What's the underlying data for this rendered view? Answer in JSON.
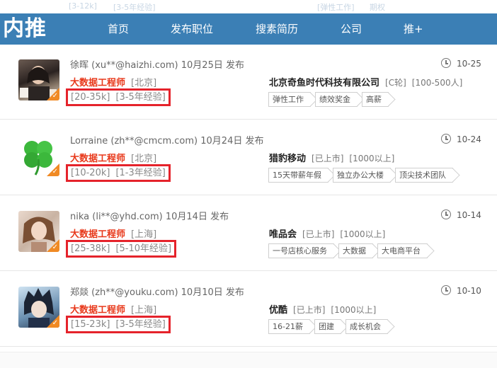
{
  "header": {
    "logo": "内推",
    "nav": [
      "首页",
      "发布职位",
      "搜素简历",
      "公司",
      "推+"
    ],
    "ghost_text": [
      "[3-12k]",
      "[3-5年经验]",
      "[弹性工作]",
      "期权"
    ]
  },
  "colors": {
    "nav_bg": "#3b7fb5",
    "job_title": "#e8381a",
    "highlight_box": "#e5232b",
    "badge": "#f08a24"
  },
  "posts": [
    {
      "poster_name": "徐晖",
      "poster_email": "(xu**@haizhi.com)",
      "posted": "10月25日 发布",
      "job_title": "大数据工程师",
      "city": "[北京]",
      "salary": "[20-35k]",
      "experience": "[3-5年经验]",
      "company": "北京奇鱼时代科技有限公司",
      "company_stage": "[C轮]",
      "company_size": "[100-500人]",
      "tags": [
        "弹性工作",
        "绩效奖金",
        "高薪"
      ],
      "date": "10-25",
      "avatar": "photo-woman-portrait"
    },
    {
      "poster_name": "Lorraine",
      "poster_email": "(zh**@cmcm.com)",
      "posted": "10月24日 发布",
      "job_title": "大数据工程师",
      "city": "[北京]",
      "salary": "[10-20k]",
      "experience": "[1-3年经验]",
      "company": "猎豹移动",
      "company_stage": "[已上市]",
      "company_size": "[1000以上]",
      "tags": [
        "15天带薪年假",
        "独立办公大楼",
        "顶尖技术团队"
      ],
      "date": "10-24",
      "avatar": "four-leaf-clover"
    },
    {
      "poster_name": "nika",
      "poster_email": "(li**@yhd.com)",
      "posted": "10月14日 发布",
      "job_title": "大数据工程师",
      "city": "[上海]",
      "salary": "[25-38k]",
      "experience": "[5-10年经验]",
      "company": "唯品会",
      "company_stage": "[已上市]",
      "company_size": "[1000以上]",
      "tags": [
        "一号店核心服务",
        "大数据",
        "大电商平台"
      ],
      "date": "10-14",
      "avatar": "photo-woman-selfie"
    },
    {
      "poster_name": "郑燚",
      "poster_email": "(zh**@youku.com)",
      "posted": "10月10日 发布",
      "job_title": "大数据工程师",
      "city": "[上海]",
      "salary": "[15-23k]",
      "experience": "[3-5年经验]",
      "company": "优酷",
      "company_stage": "[已上市]",
      "company_size": "[1000以上]",
      "tags": [
        "16-21薪",
        "团建",
        "成长机会"
      ],
      "date": "10-10",
      "avatar": "anime-character"
    }
  ]
}
